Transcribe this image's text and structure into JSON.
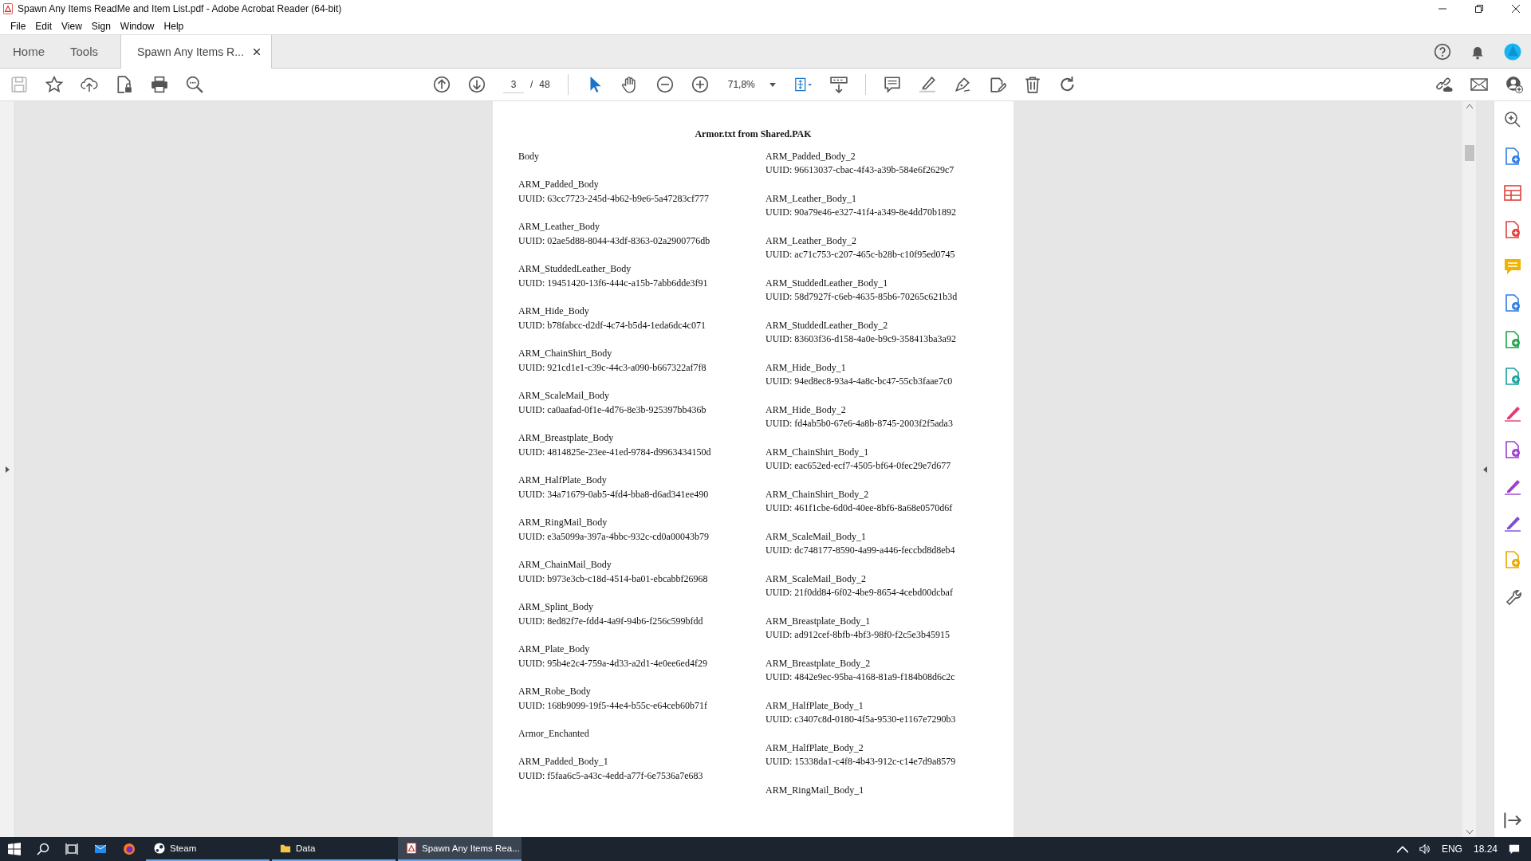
{
  "window": {
    "title": "Spawn Any Items ReadMe and Item List.pdf - Adobe Acrobat Reader (64-bit)"
  },
  "menu": [
    "File",
    "Edit",
    "View",
    "Sign",
    "Window",
    "Help"
  ],
  "tabs": [
    {
      "label": "Home",
      "kind": "nav",
      "selected": false
    },
    {
      "label": "Tools",
      "kind": "nav",
      "selected": false
    },
    {
      "label": "Spawn Any Items R...",
      "kind": "document",
      "selected": true
    }
  ],
  "toolbar": {
    "page_current": "3",
    "page_separator": "/",
    "page_total": "48",
    "zoom": "71,8%"
  },
  "document": {
    "title": "Armor.txt from Shared.PAK",
    "columns": [
      [
        {
          "kind": "heading",
          "name": "Body"
        },
        {
          "kind": "entry",
          "name": "ARM_Padded_Body",
          "uuid": "UUID: 63cc7723-245d-4b62-b9e6-5a47283cf777"
        },
        {
          "kind": "entry",
          "name": "ARM_Leather_Body",
          "uuid": "UUID: 02ae5d88-8044-43df-8363-02a2900776db"
        },
        {
          "kind": "entry",
          "name": "ARM_StuddedLeather_Body",
          "uuid": "UUID: 19451420-13f6-444c-a15b-7abb6dde3f91"
        },
        {
          "kind": "entry",
          "name": "ARM_Hide_Body",
          "uuid": "UUID: b78fabcc-d2df-4c74-b5d4-1eda6dc4c071"
        },
        {
          "kind": "entry",
          "name": "ARM_ChainShirt_Body",
          "uuid": "UUID: 921cd1e1-c39c-44c3-a090-b667322af7f8"
        },
        {
          "kind": "entry",
          "name": "ARM_ScaleMail_Body",
          "uuid": "UUID: ca0aafad-0f1e-4d76-8e3b-925397bb436b"
        },
        {
          "kind": "entry",
          "name": "ARM_Breastplate_Body",
          "uuid": "UUID: 4814825e-23ee-41ed-9784-d9963434150d"
        },
        {
          "kind": "entry",
          "name": "ARM_HalfPlate_Body",
          "uuid": "UUID: 34a71679-0ab5-4fd4-bba8-d6ad341ee490"
        },
        {
          "kind": "entry",
          "name": "ARM_RingMail_Body",
          "uuid": "UUID: e3a5099a-397a-4bbc-932c-cd0a00043b79"
        },
        {
          "kind": "entry",
          "name": "ARM_ChainMail_Body",
          "uuid": "UUID: b973e3cb-c18d-4514-ba01-ebcabbf26968"
        },
        {
          "kind": "entry",
          "name": "ARM_Splint_Body",
          "uuid": "UUID: 8ed82f7e-fdd4-4a9f-94b6-f256c599bfdd"
        },
        {
          "kind": "entry",
          "name": "ARM_Plate_Body",
          "uuid": "UUID: 95b4e2c4-759a-4d33-a2d1-4e0ee6ed4f29"
        },
        {
          "kind": "entry",
          "name": "ARM_Robe_Body",
          "uuid": "UUID: 168b9099-19f5-44e4-b55c-e64ceb60b71f"
        },
        {
          "kind": "heading",
          "name": "Armor_Enchanted"
        },
        {
          "kind": "entry",
          "name": "ARM_Padded_Body_1",
          "uuid": "UUID: f5faa6c5-a43c-4edd-a77f-6e7536a7e683"
        }
      ],
      [
        {
          "kind": "entry",
          "name": "ARM_Padded_Body_2",
          "uuid": "UUID: 96613037-cbac-4f43-a39b-584e6f2629c7"
        },
        {
          "kind": "entry",
          "name": "ARM_Leather_Body_1",
          "uuid": "UUID: 90a79e46-e327-41f4-a349-8e4dd70b1892"
        },
        {
          "kind": "entry",
          "name": "ARM_Leather_Body_2",
          "uuid": "UUID: ac71c753-c207-465c-b28b-c10f95ed0745"
        },
        {
          "kind": "entry",
          "name": "ARM_StuddedLeather_Body_1",
          "uuid": "UUID: 58d7927f-c6eb-4635-85b6-70265c621b3d"
        },
        {
          "kind": "entry",
          "name": "ARM_StuddedLeather_Body_2",
          "uuid": "UUID: 83603f36-d158-4a0e-b9c9-358413ba3a92"
        },
        {
          "kind": "entry",
          "name": "ARM_Hide_Body_1",
          "uuid": "UUID: 94ed8ec8-93a4-4a8c-bc47-55cb3faae7c0"
        },
        {
          "kind": "entry",
          "name": "ARM_Hide_Body_2",
          "uuid": "UUID: fd4ab5b0-67e6-4a8b-8745-2003f2f5ada3"
        },
        {
          "kind": "entry",
          "name": "ARM_ChainShirt_Body_1",
          "uuid": "UUID: eac652ed-ecf7-4505-bf64-0fec29e7d677"
        },
        {
          "kind": "entry",
          "name": "ARM_ChainShirt_Body_2",
          "uuid": "UUID: 461f1cbe-6d0d-40ee-8bf6-8a68e0570d6f"
        },
        {
          "kind": "entry",
          "name": "ARM_ScaleMail_Body_1",
          "uuid": "UUID: dc748177-8590-4a99-a446-feccbd8d8eb4"
        },
        {
          "kind": "entry",
          "name": "ARM_ScaleMail_Body_2",
          "uuid": "UUID: 21f0dd84-6f02-4be9-8654-4cebd00dcbaf"
        },
        {
          "kind": "entry",
          "name": "ARM_Breastplate_Body_1",
          "uuid": "UUID: ad912cef-8bfb-4bf3-98f0-f2c5e3b45915"
        },
        {
          "kind": "entry",
          "name": "ARM_Breastplate_Body_2",
          "uuid": "UUID: 4842e9ec-95ba-4168-81a9-f184b08d6c2c"
        },
        {
          "kind": "entry",
          "name": "ARM_HalfPlate_Body_1",
          "uuid": "UUID: c3407c8d-0180-4f5a-9530-e1167e7290b3"
        },
        {
          "kind": "entry",
          "name": "ARM_HalfPlate_Body_2",
          "uuid": "UUID: 15338da1-c4f8-4b43-912c-c14e7d9a8579"
        },
        {
          "kind": "entry",
          "name": "ARM_RingMail_Body_1"
        }
      ]
    ]
  },
  "taskbar": {
    "items": [
      {
        "kind": "steam",
        "label": "Steam",
        "selected": false
      },
      {
        "kind": "folder",
        "label": "Data",
        "selected": false
      },
      {
        "kind": "pdf",
        "label": "Spawn Any Items Rea...",
        "selected": true
      }
    ],
    "language": "ENG",
    "time": "18.24"
  }
}
